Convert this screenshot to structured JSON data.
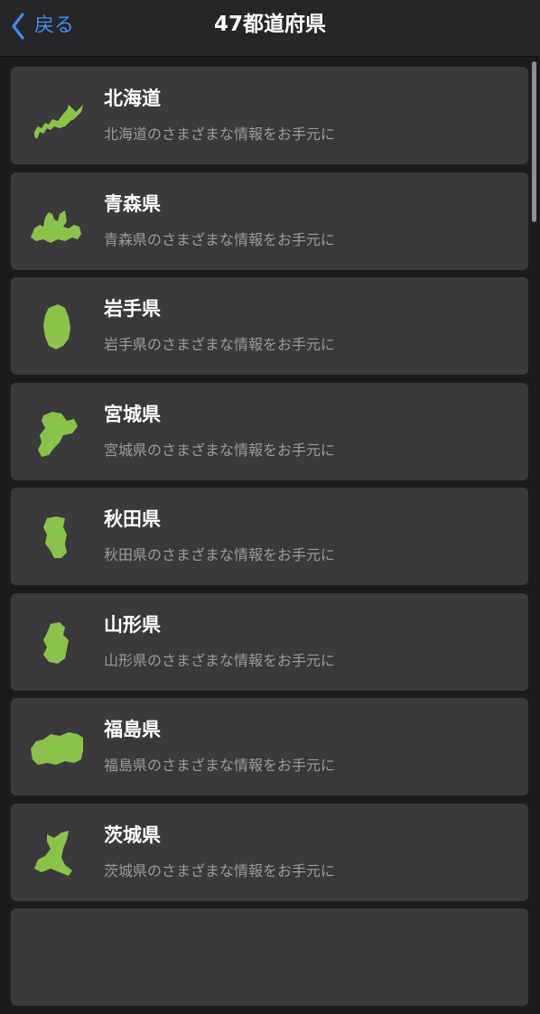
{
  "nav": {
    "back_label": "戻る",
    "title": "47都道府県"
  },
  "accent": "#3d8fe3",
  "map_color": "#8bc34a",
  "prefectures": [
    {
      "name": "北海道",
      "subtitle": "北海道のさまざまな情報をお手元に",
      "icon": "hokkaido-map-icon"
    },
    {
      "name": "青森県",
      "subtitle": "青森県のさまざまな情報をお手元に",
      "icon": "aomori-map-icon"
    },
    {
      "name": "岩手県",
      "subtitle": "岩手県のさまざまな情報をお手元に",
      "icon": "iwate-map-icon"
    },
    {
      "name": "宮城県",
      "subtitle": "宮城県のさまざまな情報をお手元に",
      "icon": "miyagi-map-icon"
    },
    {
      "name": "秋田県",
      "subtitle": "秋田県のさまざまな情報をお手元に",
      "icon": "akita-map-icon"
    },
    {
      "name": "山形県",
      "subtitle": "山形県のさまざまな情報をお手元に",
      "icon": "yamagata-map-icon"
    },
    {
      "name": "福島県",
      "subtitle": "福島県のさまざまな情報をお手元に",
      "icon": "fukushima-map-icon"
    },
    {
      "name": "茨城県",
      "subtitle": "茨城県のさまざまな情報をお手元に",
      "icon": "ibaraki-map-icon"
    },
    {
      "name": "",
      "subtitle": "",
      "icon": "map-icon"
    }
  ]
}
